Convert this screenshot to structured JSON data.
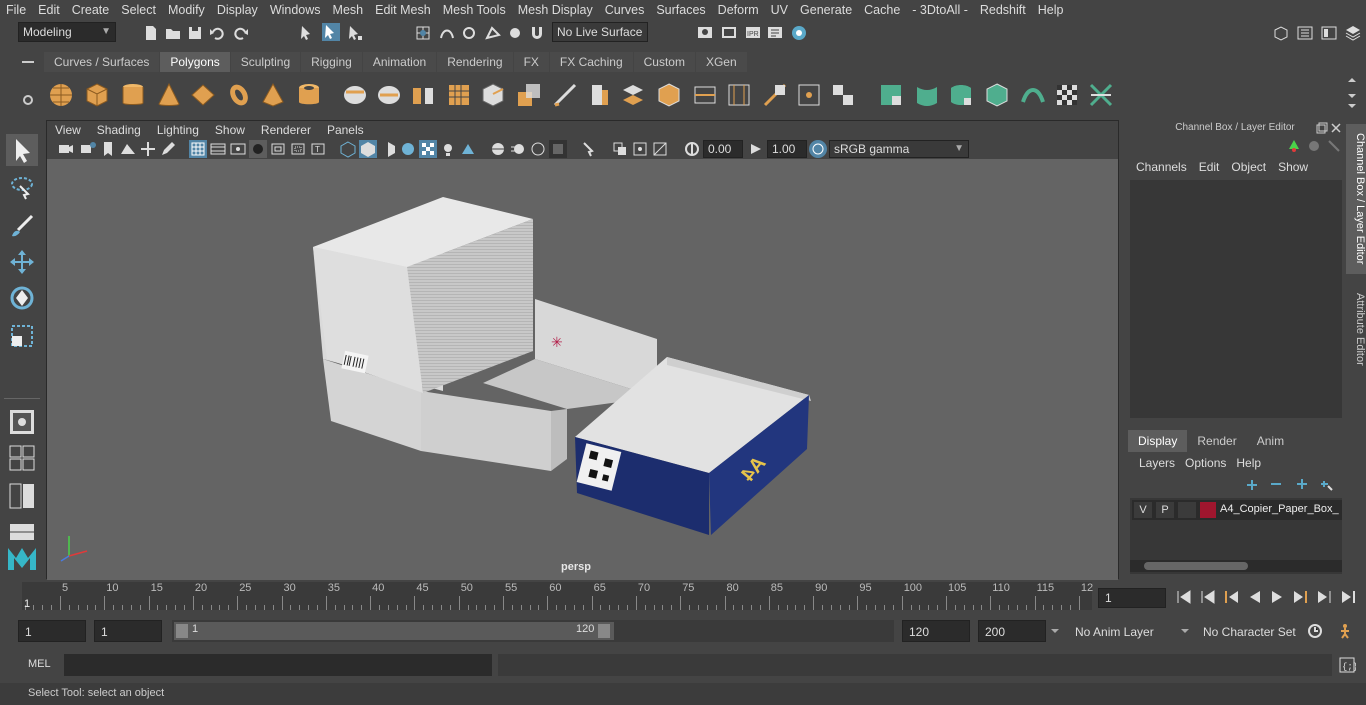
{
  "menubar": {
    "items": [
      "File",
      "Edit",
      "Create",
      "Select",
      "Modify",
      "Display",
      "Windows",
      "Mesh",
      "Edit Mesh",
      "Mesh Tools",
      "Mesh Display",
      "Curves",
      "Surfaces",
      "Deform",
      "UV",
      "Generate",
      "Cache",
      "- 3DtoAll -",
      "Redshift",
      "Help"
    ]
  },
  "statusline": {
    "mode_value": "Modeling",
    "live_surface": "No Live Surface"
  },
  "shelf": {
    "tabs": [
      "Curves / Surfaces",
      "Polygons",
      "Sculpting",
      "Rigging",
      "Animation",
      "Rendering",
      "FX",
      "FX Caching",
      "Custom",
      "XGen"
    ],
    "active_tab": "Polygons"
  },
  "viewport": {
    "menu": [
      "View",
      "Shading",
      "Lighting",
      "Show",
      "Renderer",
      "Panels"
    ],
    "exposure": "0.00",
    "gamma": "1.00",
    "color_space": "sRGB gamma",
    "camera_label": "persp"
  },
  "right_panel": {
    "title": "Channel Box / Layer Editor",
    "channel_menu": [
      "Channels",
      "Edit",
      "Object",
      "Show"
    ],
    "layer_tabs": [
      "Display",
      "Render",
      "Anim"
    ],
    "active_layer_tab": "Display",
    "layer_menu": [
      "Layers",
      "Options",
      "Help"
    ],
    "layer": {
      "v": "V",
      "p": "P",
      "name": "A4_Copier_Paper_Box_",
      "color": "#a0162e"
    },
    "side_tabs": [
      "Channel Box / Layer Editor",
      "Attribute Editor"
    ]
  },
  "timeline": {
    "ticks": [
      "5",
      "10",
      "15",
      "20",
      "25",
      "30",
      "35",
      "40",
      "45",
      "50",
      "55",
      "60",
      "65",
      "70",
      "75",
      "80",
      "85",
      "90",
      "95",
      "100",
      "105",
      "110",
      "115",
      "12"
    ],
    "start_marker": "1",
    "current_frame": "1"
  },
  "range": {
    "start": "1",
    "playback_start": "1",
    "slider_start": "1",
    "slider_end": "120",
    "playback_end": "120",
    "end": "200",
    "anim_layer": "No Anim Layer",
    "character_set": "No Character Set"
  },
  "command": {
    "label": "MEL"
  },
  "help": {
    "text": "Select Tool: select an object"
  },
  "colors": {
    "accent": "#5285a6",
    "box_blue": "#1c2d6e",
    "shelf_orange": "#e0a050",
    "shelf_green": "#4fae8e"
  }
}
